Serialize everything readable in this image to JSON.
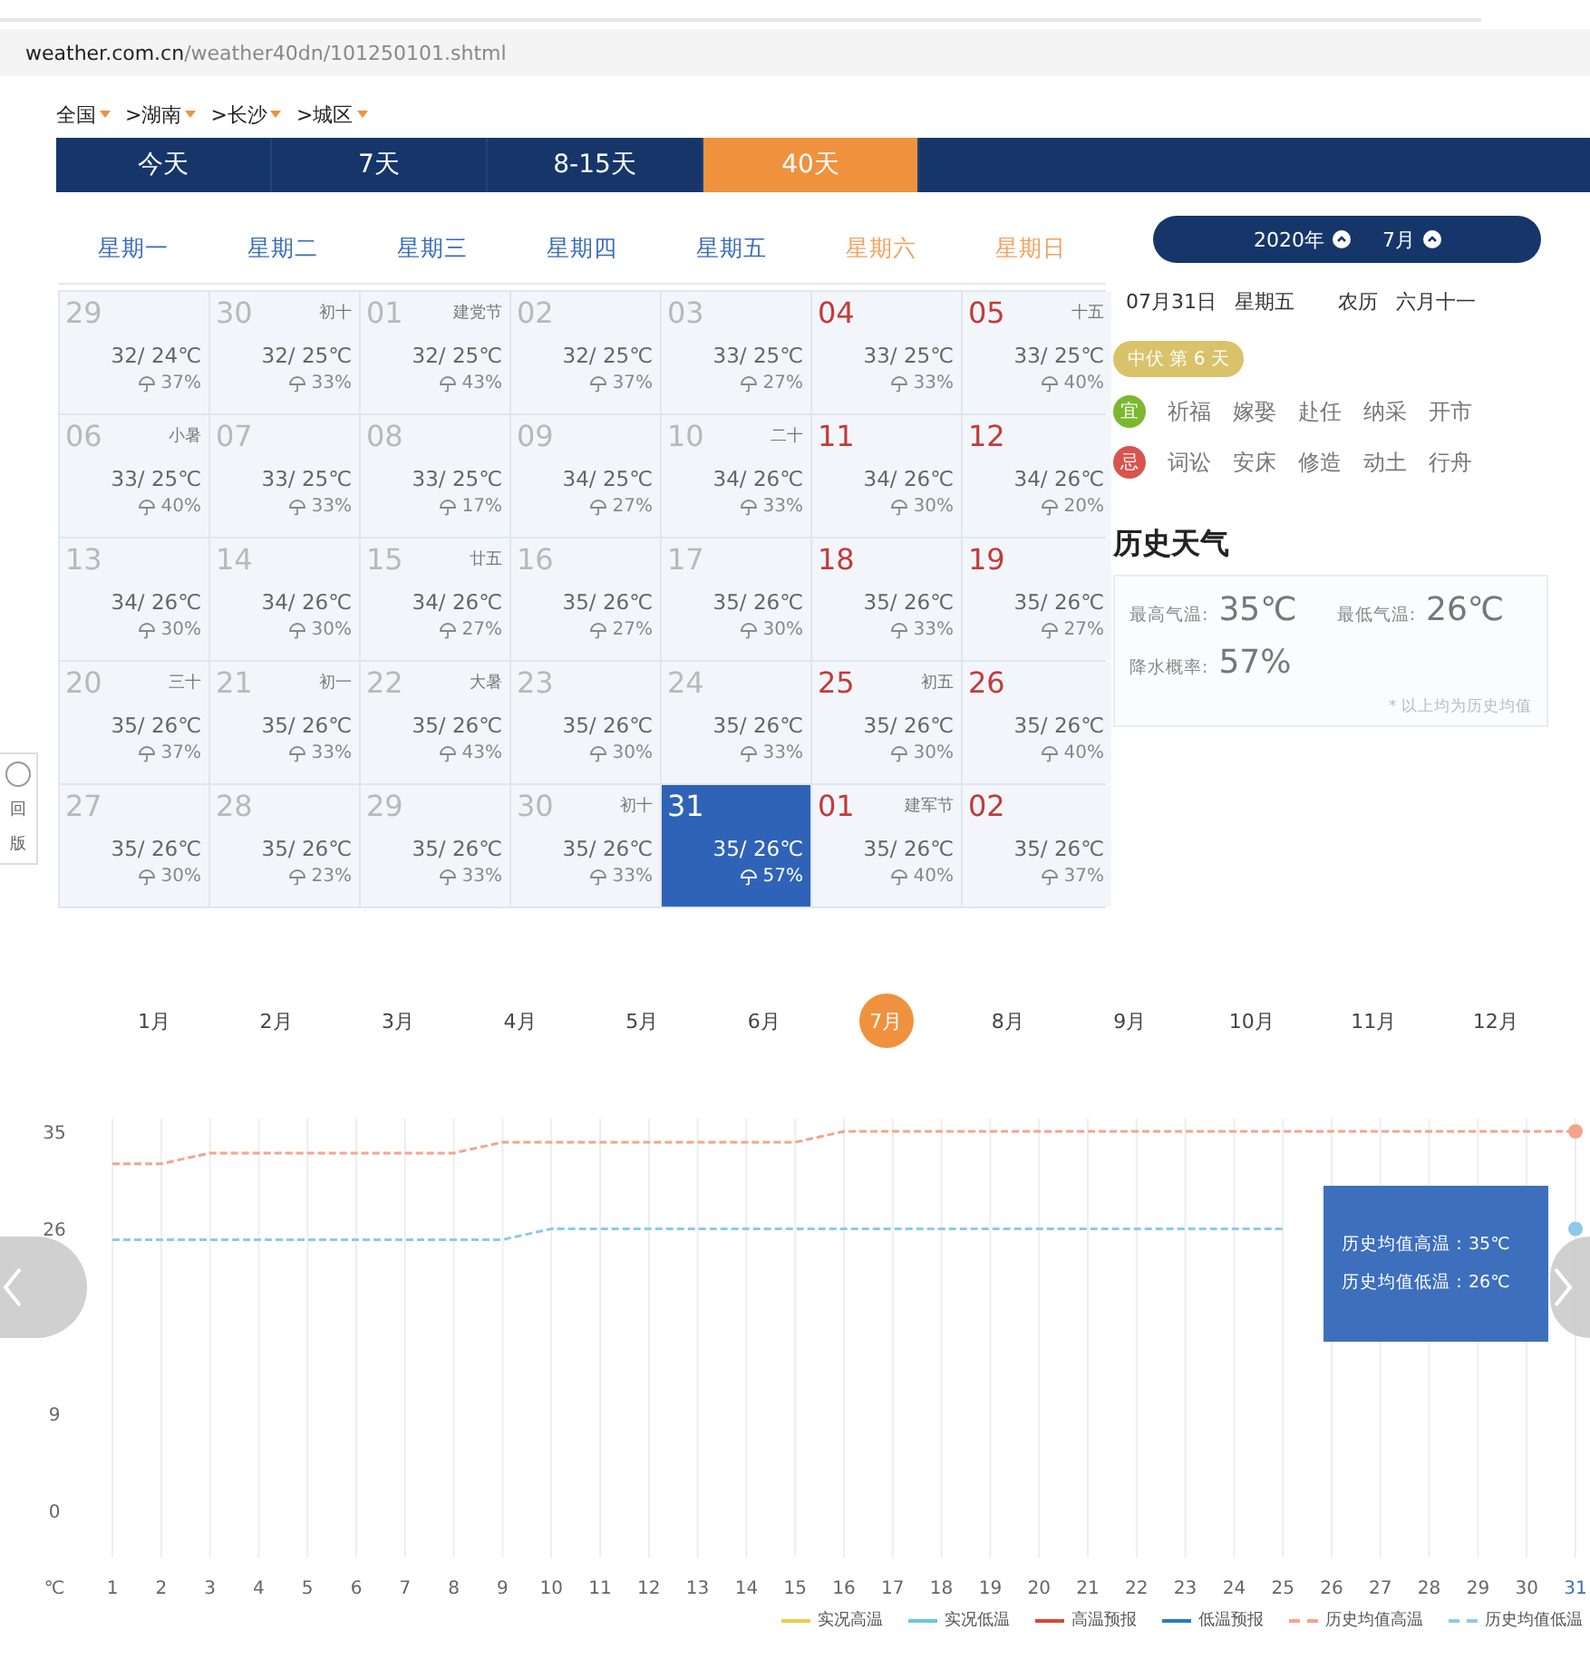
{
  "address_bar": {
    "host": "weather.com.cn",
    "path": "/weather40dn/101250101.shtml"
  },
  "breadcrumb": [
    "全国",
    ">湖南",
    ">长沙",
    ">城区"
  ],
  "tabs": [
    {
      "label": "今天",
      "selected": false
    },
    {
      "label": "7天",
      "selected": false
    },
    {
      "label": "8-15天",
      "selected": false
    },
    {
      "label": "40天",
      "selected": true
    }
  ],
  "side_tab": [
    "回",
    "版"
  ],
  "weekdays": [
    {
      "label": "星期一",
      "weekend": false
    },
    {
      "label": "星期二",
      "weekend": false
    },
    {
      "label": "星期三",
      "weekend": false
    },
    {
      "label": "星期四",
      "weekend": false
    },
    {
      "label": "星期五",
      "weekend": false
    },
    {
      "label": "星期六",
      "weekend": true
    },
    {
      "label": "星期日",
      "weekend": true
    }
  ],
  "calendar": [
    [
      {
        "date": "29",
        "temp": "32/ 24℃",
        "rain": "37%",
        "dimmed": true,
        "selected": false
      },
      {
        "date": "30",
        "note": "初十",
        "temp": "32/ 25℃",
        "rain": "33%",
        "dimmed": true,
        "selected": false
      },
      {
        "date": "01",
        "note": "建党节",
        "temp": "32/ 25℃",
        "rain": "43%",
        "dimmed": true,
        "selected": false
      },
      {
        "date": "02",
        "temp": "32/ 25℃",
        "rain": "37%",
        "dimmed": true,
        "selected": false
      },
      {
        "date": "03",
        "temp": "33/ 25℃",
        "rain": "27%",
        "dimmed": true,
        "selected": false
      },
      {
        "date": "04",
        "temp": "33/ 25℃",
        "rain": "33%",
        "dimmed": false,
        "selected": false
      },
      {
        "date": "05",
        "note": "十五",
        "temp": "33/ 25℃",
        "rain": "40%",
        "dimmed": false,
        "selected": false
      }
    ],
    [
      {
        "date": "06",
        "note": "小暑",
        "temp": "33/ 25℃",
        "rain": "40%",
        "dimmed": true,
        "selected": false
      },
      {
        "date": "07",
        "temp": "33/ 25℃",
        "rain": "33%",
        "dimmed": true,
        "selected": false
      },
      {
        "date": "08",
        "temp": "33/ 25℃",
        "rain": "17%",
        "dimmed": true,
        "selected": false
      },
      {
        "date": "09",
        "temp": "34/ 25℃",
        "rain": "27%",
        "dimmed": true,
        "selected": false
      },
      {
        "date": "10",
        "note": "二十",
        "temp": "34/ 26℃",
        "rain": "33%",
        "dimmed": true,
        "selected": false
      },
      {
        "date": "11",
        "temp": "34/ 26℃",
        "rain": "30%",
        "dimmed": false,
        "selected": false
      },
      {
        "date": "12",
        "temp": "34/ 26℃",
        "rain": "20%",
        "dimmed": false,
        "selected": false
      }
    ],
    [
      {
        "date": "13",
        "temp": "34/ 26℃",
        "rain": "30%",
        "dimmed": true,
        "selected": false
      },
      {
        "date": "14",
        "temp": "34/ 26℃",
        "rain": "30%",
        "dimmed": true,
        "selected": false
      },
      {
        "date": "15",
        "note": "廿五",
        "temp": "34/ 26℃",
        "rain": "27%",
        "dimmed": true,
        "selected": false
      },
      {
        "date": "16",
        "temp": "35/ 26℃",
        "rain": "27%",
        "dimmed": true,
        "selected": false
      },
      {
        "date": "17",
        "temp": "35/ 26℃",
        "rain": "30%",
        "dimmed": true,
        "selected": false
      },
      {
        "date": "18",
        "temp": "35/ 26℃",
        "rain": "33%",
        "dimmed": false,
        "selected": false
      },
      {
        "date": "19",
        "temp": "35/ 26℃",
        "rain": "27%",
        "dimmed": false,
        "selected": false
      }
    ],
    [
      {
        "date": "20",
        "note": "三十",
        "temp": "35/ 26℃",
        "rain": "37%",
        "dimmed": true,
        "selected": false
      },
      {
        "date": "21",
        "note": "初一",
        "temp": "35/ 26℃",
        "rain": "33%",
        "dimmed": true,
        "selected": false
      },
      {
        "date": "22",
        "note": "大暑",
        "temp": "35/ 26℃",
        "rain": "43%",
        "dimmed": true,
        "selected": false
      },
      {
        "date": "23",
        "temp": "35/ 26℃",
        "rain": "30%",
        "dimmed": true,
        "selected": false
      },
      {
        "date": "24",
        "temp": "35/ 26℃",
        "rain": "33%",
        "dimmed": true,
        "selected": false
      },
      {
        "date": "25",
        "note": "初五",
        "temp": "35/ 26℃",
        "rain": "30%",
        "dimmed": false,
        "selected": false
      },
      {
        "date": "26",
        "temp": "35/ 26℃",
        "rain": "40%",
        "dimmed": false,
        "selected": false
      }
    ],
    [
      {
        "date": "27",
        "temp": "35/ 26℃",
        "rain": "30%",
        "dimmed": true,
        "selected": false
      },
      {
        "date": "28",
        "temp": "35/ 26℃",
        "rain": "23%",
        "dimmed": true,
        "selected": false
      },
      {
        "date": "29",
        "temp": "35/ 26℃",
        "rain": "33%",
        "dimmed": true,
        "selected": false
      },
      {
        "date": "30",
        "note": "初十",
        "temp": "35/ 26℃",
        "rain": "33%",
        "dimmed": true,
        "selected": false
      },
      {
        "date": "31",
        "temp": "35/ 26℃",
        "rain": "57%",
        "dimmed": false,
        "selected": true
      },
      {
        "date": "01",
        "note": "建军节",
        "temp": "35/ 26℃",
        "rain": "40%",
        "dimmed": false,
        "selected": false
      },
      {
        "date": "02",
        "temp": "35/ 26℃",
        "rain": "37%",
        "dimmed": false,
        "selected": false
      }
    ]
  ],
  "side": {
    "year": "2020年",
    "month": "7月",
    "date": "07月31日",
    "weekday": "星期五",
    "lunar_label": "农历",
    "lunar_date": "六月十一",
    "badge": "中伏 第 6 天",
    "almanac": [
      {
        "mark": "宜",
        "color": "#7cb82f",
        "items": [
          "祈福",
          "嫁娶",
          "赴任",
          "纳采",
          "开市"
        ]
      },
      {
        "mark": "忌",
        "color": "#d9534f",
        "items": [
          "词讼",
          "安床",
          "修造",
          "动土",
          "行舟"
        ]
      }
    ],
    "history_title": "历史天气",
    "history": {
      "high_label": "最高气温:",
      "high": "35℃",
      "low_label": "最低气温:",
      "low": "26℃",
      "rain_label": "降水概率:",
      "rain": "57%",
      "note": "* 以上均为历史均值"
    }
  },
  "months": [
    {
      "label": "1月",
      "selected": false
    },
    {
      "label": "2月",
      "selected": false
    },
    {
      "label": "3月",
      "selected": false
    },
    {
      "label": "4月",
      "selected": false
    },
    {
      "label": "5月",
      "selected": false
    },
    {
      "label": "6月",
      "selected": false
    },
    {
      "label": "7月",
      "selected": true
    },
    {
      "label": "8月",
      "selected": false
    },
    {
      "label": "9月",
      "selected": false
    },
    {
      "label": "10月",
      "selected": false
    },
    {
      "label": "11月",
      "selected": false
    },
    {
      "label": "12月",
      "selected": false
    }
  ],
  "chart": {
    "chart_data": {
      "type": "line",
      "ylabel": "℃",
      "x": [
        1,
        2,
        3,
        4,
        5,
        6,
        7,
        8,
        9,
        10,
        11,
        12,
        13,
        14,
        15,
        16,
        17,
        18,
        19,
        20,
        21,
        22,
        23,
        24,
        25,
        26,
        27,
        28,
        29,
        30,
        31
      ],
      "ylim": [
        0,
        35
      ],
      "yticks": [
        0,
        9,
        26,
        35
      ],
      "grid": true,
      "legend": true,
      "series": [
        {
          "name": "实况高温",
          "color": "#f2c94c",
          "line_style": "solid",
          "values": [
            null,
            null,
            null,
            null,
            null,
            null,
            null,
            null,
            null,
            null,
            null,
            null,
            null,
            null,
            null,
            null,
            null,
            null,
            null,
            null,
            null,
            null,
            null,
            null,
            null,
            null,
            null,
            null,
            null,
            null,
            null
          ]
        },
        {
          "name": "实况低温",
          "color": "#6cc7d9",
          "line_style": "solid",
          "values": [
            null,
            null,
            null,
            null,
            null,
            null,
            null,
            null,
            null,
            null,
            null,
            null,
            null,
            null,
            null,
            null,
            null,
            null,
            null,
            null,
            null,
            null,
            null,
            null,
            null,
            null,
            null,
            null,
            null,
            null,
            null
          ]
        },
        {
          "name": "高温预报",
          "color": "#d9482b",
          "line_style": "solid",
          "values": [
            null,
            null,
            null,
            null,
            null,
            null,
            null,
            null,
            null,
            null,
            null,
            null,
            null,
            null,
            null,
            null,
            null,
            null,
            null,
            null,
            null,
            null,
            null,
            null,
            null,
            null,
            null,
            null,
            null,
            null,
            null
          ]
        },
        {
          "name": "低温预报",
          "color": "#2b7bb9",
          "line_style": "solid",
          "values": [
            null,
            null,
            null,
            null,
            null,
            null,
            null,
            null,
            null,
            null,
            null,
            null,
            null,
            null,
            null,
            null,
            null,
            null,
            null,
            null,
            null,
            null,
            null,
            null,
            null,
            null,
            null,
            null,
            null,
            null,
            null
          ]
        },
        {
          "name": "历史均值高温",
          "color": "#f4a48c",
          "line_style": "dashed",
          "values": [
            32,
            32,
            33,
            33,
            33,
            33,
            33,
            33,
            34,
            34,
            34,
            34,
            34,
            34,
            34,
            35,
            35,
            35,
            35,
            35,
            35,
            35,
            35,
            35,
            35,
            35,
            35,
            35,
            35,
            35,
            35
          ]
        },
        {
          "name": "历史均值低温",
          "color": "#8ccbe8",
          "line_style": "dashed",
          "values": [
            25,
            25,
            25,
            25,
            25,
            25,
            25,
            25,
            25,
            26,
            26,
            26,
            26,
            26,
            26,
            26,
            26,
            26,
            26,
            26,
            26,
            26,
            26,
            26,
            26,
            null,
            null,
            null,
            null,
            null,
            26
          ]
        }
      ]
    },
    "tooltip": [
      "历史均值高温：35℃",
      "历史均值低温：26℃"
    ]
  }
}
